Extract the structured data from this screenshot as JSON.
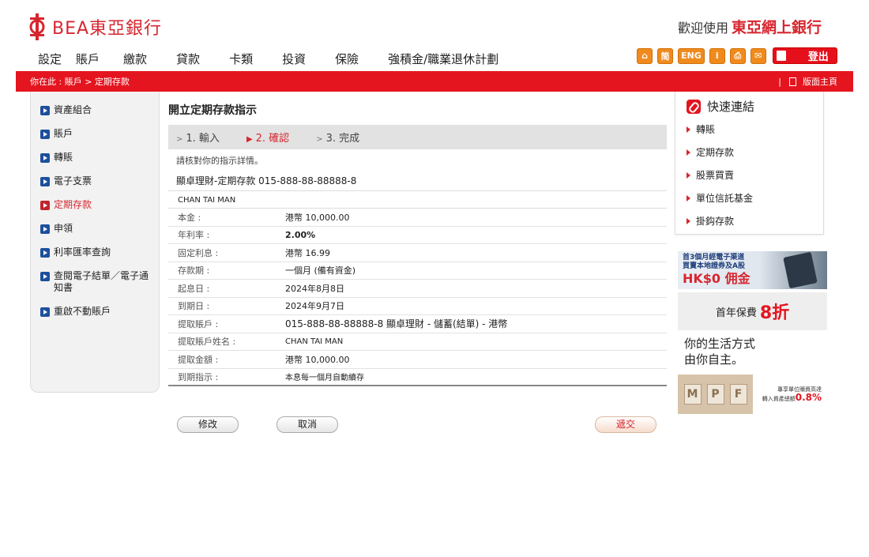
{
  "header": {
    "brand": "BEA東亞銀行",
    "welcome": "歡迎使用",
    "welcome_brand": "東亞網上銀行"
  },
  "topnav": [
    "設定",
    "賬戶",
    "繳款",
    "貸款",
    "卡類",
    "投資",
    "保險",
    "強積金/職業退休計劃"
  ],
  "tools": {
    "home": "⌂",
    "simplified": "简",
    "english": "ENG",
    "info": "i",
    "print": "⎙",
    "mail": "✉",
    "logout": "登出"
  },
  "breadcrumb": "你在此 : 賬戶 > 定期存款",
  "sitemap": "版面主頁",
  "sidebar": {
    "items": [
      {
        "label": "資產組合"
      },
      {
        "label": "賬戶"
      },
      {
        "label": "轉賬"
      },
      {
        "label": "電子支票"
      },
      {
        "label": "定期存款"
      },
      {
        "label": "申領"
      },
      {
        "label": "利率匯率查詢"
      },
      {
        "label": "查閱電子結單／電子通知書"
      },
      {
        "label": "重啟不動賬戶"
      }
    ]
  },
  "main": {
    "title": "開立定期存款指示",
    "steps": [
      "1. 輸入",
      "2. 確認",
      "3. 完成"
    ],
    "instruction": "請核對你的指示詳情。",
    "account_line": "顯卓理財-定期存款  015-888-88-88888-8",
    "holder": "CHAN TAI MAN",
    "rows": [
      {
        "label": "本金 :",
        "value": "港幣 10,000.00"
      },
      {
        "label": "年利率 :",
        "value": "2.00%"
      },
      {
        "label": "固定利息 :",
        "value": "港幣 16.99"
      },
      {
        "label": "存款期 :",
        "value": "一個月 (備有資金)"
      },
      {
        "label": "起息日 :",
        "value": "2024年8月8日"
      },
      {
        "label": "到期日 :",
        "value": "2024年9月7日"
      },
      {
        "label": "提取賬戶 :",
        "value": "015-888-88-88888-8 顯卓理財 - 儲蓄(結單) - 港幣"
      },
      {
        "label": "提取賬戶姓名 :",
        "value": "CHAN TAI MAN"
      },
      {
        "label": "提取金額 :",
        "value": "港幣  10,000.00"
      },
      {
        "label": "到期指示 :",
        "value": "本息每一個月自動續存"
      }
    ],
    "buttons": {
      "modify": "修改",
      "cancel": "取消",
      "submit": "遞交"
    }
  },
  "quick_links": {
    "title": "快速連結",
    "items": [
      "轉賬",
      "定期存款",
      "股票買賣",
      "單位信託基金",
      "掛鈎存款"
    ]
  },
  "promos": {
    "ad1_line1": "首3個月經電子渠道",
    "ad1_line2": "買賣本地證券及A股",
    "ad1_big": "HK$0 佣金",
    "ad2_text": "首年保費",
    "ad2_num": "8折",
    "ad3_line1": "你的生活方式",
    "ad3_line2": "由你自主。",
    "ad4_letters": [
      "M",
      "P",
      "F"
    ],
    "ad4_line1": "專享單位贖資高達",
    "ad4_line2": "轉入資產總額",
    "ad4_pct": "0.8%"
  },
  "colors": {
    "brand_red": "#e4151f",
    "nav_blue": "#1d4f9c",
    "tool_orange": "#f08a1d"
  }
}
